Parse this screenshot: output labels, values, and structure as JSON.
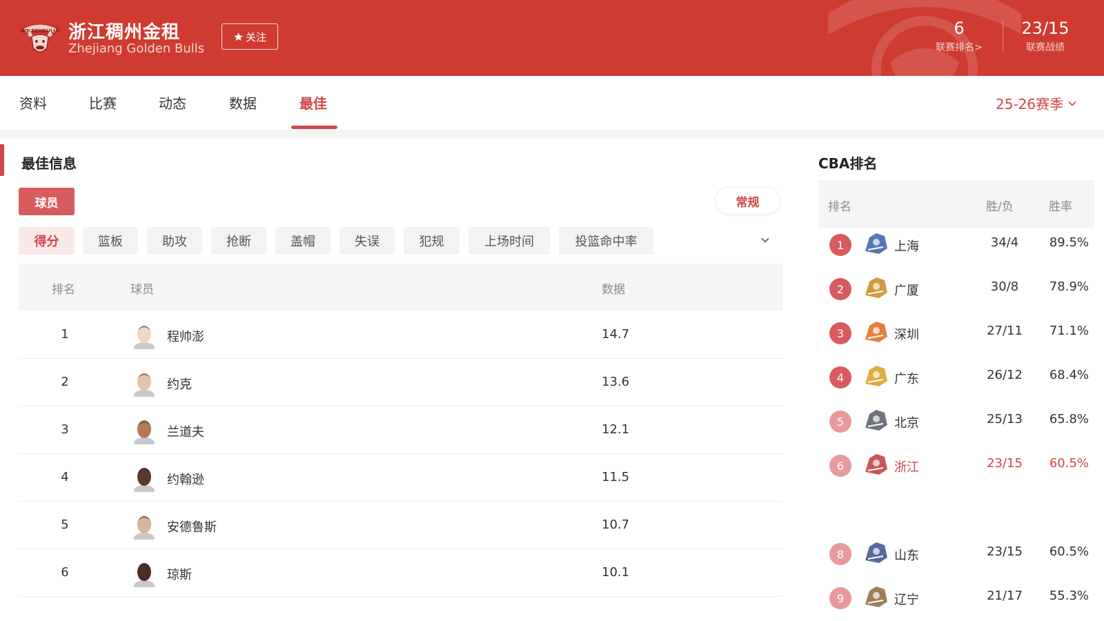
{
  "header": {
    "team_name_cn": "浙江稠州金租",
    "team_name_en": "Zhejiang Golden Bulls",
    "follow_label": "关注",
    "league_rank_value": "6",
    "league_rank_label": "联赛排名>",
    "league_record_value": "23/15",
    "league_record_label": "联赛战绩"
  },
  "nav": {
    "tabs": [
      "资料",
      "比赛",
      "动态",
      "数据",
      "最佳"
    ],
    "active_tab": "最佳",
    "season": "25-26赛季"
  },
  "best": {
    "title": "最佳信息",
    "type_label": "球员",
    "mode_label": "常规",
    "categories": [
      "得分",
      "篮板",
      "助攻",
      "抢断",
      "盖帽",
      "失误",
      "犯规",
      "上场时间",
      "投篮命中率"
    ],
    "active_category": "得分",
    "table_headers": {
      "rank": "排名",
      "player": "球员",
      "value": "数据"
    },
    "rows": [
      {
        "rank": "1",
        "name": "程帅澎",
        "value": "14.7"
      },
      {
        "rank": "2",
        "name": "约克",
        "value": "13.6"
      },
      {
        "rank": "3",
        "name": "兰道夫",
        "value": "12.1"
      },
      {
        "rank": "4",
        "name": "约翰逊",
        "value": "11.5"
      },
      {
        "rank": "5",
        "name": "安德鲁斯",
        "value": "10.7"
      },
      {
        "rank": "6",
        "name": "琼斯",
        "value": "10.1"
      }
    ]
  },
  "cba_ranking": {
    "title": "CBA排名",
    "headers": {
      "rank": "排名",
      "wl": "胜/负",
      "pct": "胜率"
    },
    "rows": [
      {
        "rank": "1",
        "team": "上海",
        "wl": "34/4",
        "pct": "89.5%"
      },
      {
        "rank": "2",
        "team": "广厦",
        "wl": "30/8",
        "pct": "78.9%"
      },
      {
        "rank": "3",
        "team": "深圳",
        "wl": "27/11",
        "pct": "71.1%"
      },
      {
        "rank": "4",
        "team": "广东",
        "wl": "26/12",
        "pct": "68.4%"
      },
      {
        "rank": "5",
        "team": "北京",
        "wl": "25/13",
        "pct": "65.8%"
      },
      {
        "rank": "6",
        "team": "浙江",
        "wl": "23/15",
        "pct": "60.5%",
        "highlight": true
      },
      {
        "rank": "8",
        "team": "山东",
        "wl": "23/15",
        "pct": "60.5%"
      },
      {
        "rank": "9",
        "team": "辽宁",
        "wl": "21/17",
        "pct": "55.3%"
      }
    ]
  },
  "colors": {
    "brand_red": "#cf3b31",
    "accent_red": "#d0454a",
    "rank_badge_top4": "#d85b5e",
    "rank_badge_rest": "#e79a9b"
  }
}
